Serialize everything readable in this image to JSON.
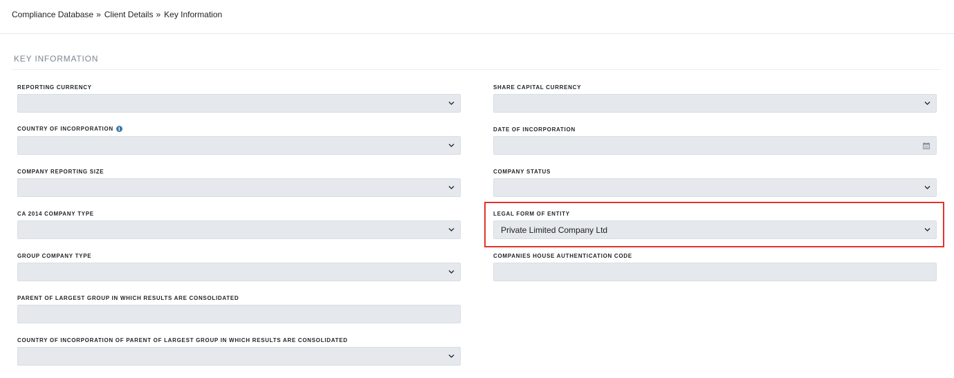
{
  "breadcrumb": {
    "items": [
      "Compliance Database",
      "Client Details",
      "Key Information"
    ],
    "separator": "»"
  },
  "section": {
    "title": "KEY INFORMATION"
  },
  "left_fields": [
    {
      "label": "REPORTING CURRENCY",
      "value": "",
      "control": "select"
    },
    {
      "label": "COUNTRY OF INCORPORATION",
      "value": "",
      "control": "select",
      "info_icon": true
    },
    {
      "label": "COMPANY REPORTING SIZE",
      "value": "",
      "control": "select"
    },
    {
      "label": "CA 2014 COMPANY TYPE",
      "value": "",
      "control": "select"
    },
    {
      "label": "GROUP COMPANY TYPE",
      "value": "",
      "control": "select"
    },
    {
      "label": "PARENT OF LARGEST GROUP IN WHICH RESULTS ARE CONSOLIDATED",
      "value": "",
      "control": "text"
    },
    {
      "label": "COUNTRY OF INCORPORATION OF PARENT OF LARGEST GROUP IN WHICH RESULTS ARE CONSOLIDATED",
      "value": "",
      "control": "select"
    }
  ],
  "right_fields": [
    {
      "label": "SHARE CAPITAL CURRENCY",
      "value": "",
      "control": "select"
    },
    {
      "label": "DATE OF INCORPORATION",
      "value": "",
      "control": "date"
    },
    {
      "label": "COMPANY STATUS",
      "value": "",
      "control": "select"
    },
    {
      "label": "LEGAL FORM OF ENTITY",
      "value": "Private Limited Company Ltd",
      "control": "select",
      "highlighted": true
    },
    {
      "label": "COMPANIES HOUSE AUTHENTICATION CODE",
      "value": "",
      "control": "text"
    }
  ],
  "colors": {
    "field_bg": "#e5e8ec",
    "highlight": "#e1322b",
    "info_icon": "#3b79a8"
  },
  "icons": {
    "select": "chevron-down-icon",
    "date": "calendar-icon",
    "info": "info-circle-icon"
  }
}
